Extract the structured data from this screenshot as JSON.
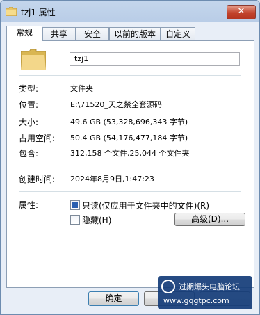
{
  "window": {
    "title": "tzj1 属性",
    "close_glyph": "✕"
  },
  "tabs": [
    {
      "label": "常规",
      "active": true
    },
    {
      "label": "共享",
      "active": false
    },
    {
      "label": "安全",
      "active": false
    },
    {
      "label": "以前的版本",
      "active": false
    },
    {
      "label": "自定义",
      "active": false
    }
  ],
  "general": {
    "name_value": "tzj1",
    "type_label": "类型:",
    "type_value": "文件夹",
    "location_label": "位置:",
    "location_value": "E:\\71520_天之禁全套源码",
    "size_label": "大小:",
    "size_value": "49.6 GB (53,328,696,343 字节)",
    "disk_size_label": "占用空间:",
    "disk_size_value": "50.4 GB (54,176,477,184 字节)",
    "contains_label": "包含:",
    "contains_value": "312,158 个文件,25,044 个文件夹",
    "created_label": "创建时间:",
    "created_value": "2024年8月9日,1:47:23",
    "attributes_label": "属性:",
    "readonly_label": "只读(仅应用于文件夹中的文件)(R)",
    "readonly_state": "indeterminate",
    "hidden_label": "隐藏(H)",
    "hidden_state": "unchecked",
    "advanced_label": "高级(D)..."
  },
  "buttons": {
    "ok": "确定",
    "cancel": "",
    "apply": ""
  },
  "watermark": {
    "line1": "过期爆头电脑论坛",
    "line2": "www.gqgtpc.com"
  },
  "colors": {
    "title_gradient": "#c4d6ec",
    "close": "#c2432c",
    "checkbox_fill": "#2a60b0"
  },
  "icons": {
    "title": "folder-icon",
    "large": "folder-icon"
  }
}
